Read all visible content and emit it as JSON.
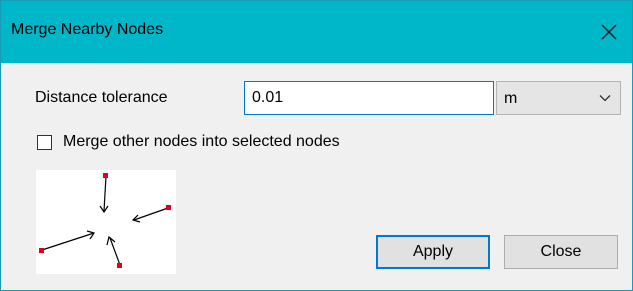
{
  "window": {
    "title": "Merge Nearby Nodes",
    "close_glyph": "×"
  },
  "form": {
    "distance_label": "Distance tolerance",
    "distance_value": "0.01",
    "unit_selected": "m",
    "merge_label": "Merge other nodes into selected nodes",
    "merge_checked": false
  },
  "buttons": {
    "apply_label": "Apply",
    "close_label": "Close"
  },
  "icons": {
    "title_close": "close-icon",
    "dropdown": "chevron-down-icon",
    "diagram": "merge-nodes-diagram"
  },
  "colors": {
    "title_bar": "#00b6c9",
    "focus_border": "#0078d7",
    "node": "#e0001b"
  }
}
